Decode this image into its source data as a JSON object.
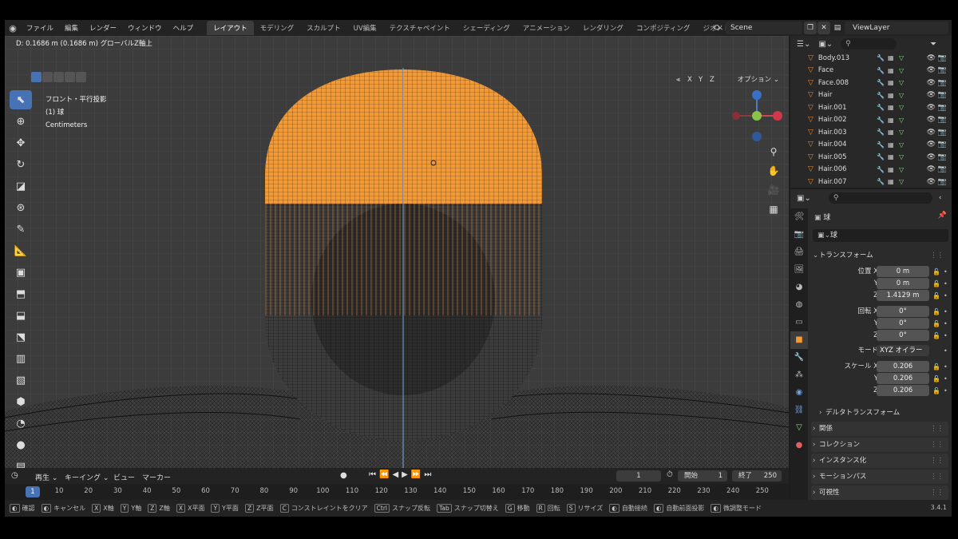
{
  "menu": [
    "ファイル",
    "編集",
    "レンダー",
    "ウィンドウ",
    "ヘルプ"
  ],
  "workspace_tabs": [
    "レイアウト",
    "モデリング",
    "スカルプト",
    "UV編集",
    "テクスチャペイント",
    "シェーディング",
    "アニメーション",
    "レンダリング",
    "コンポジティング",
    "ジオメトリ"
  ],
  "scene": "Scene",
  "view_layer": "ViewLayer",
  "viewport": {
    "status": "D: 0.1686 m (0.1686 m) グローバルZ軸上",
    "view_name": "フロント・平行投影",
    "object_info": "(1) 球",
    "units": "Centimeters",
    "axes_buttons": [
      "X",
      "Y",
      "Z"
    ],
    "option_label": "オプション"
  },
  "timeline": {
    "playback": "再生",
    "keying": "キーイング",
    "view": "ビュー",
    "marker": "マーカー",
    "current_frame": "1",
    "start_label": "開始",
    "start": "1",
    "end_label": "終了",
    "end": "250",
    "ruler": [
      "1",
      "10",
      "20",
      "30",
      "40",
      "50",
      "60",
      "70",
      "80",
      "90",
      "100",
      "110",
      "120",
      "130",
      "140",
      "150",
      "160",
      "170",
      "180",
      "190",
      "200",
      "210",
      "220",
      "230",
      "240",
      "250"
    ]
  },
  "statusbar": [
    {
      "key": "",
      "label": "確認"
    },
    {
      "key": "",
      "label": "キャンセル"
    },
    {
      "key": "X",
      "label": "X軸"
    },
    {
      "key": "Y",
      "label": "Y軸"
    },
    {
      "key": "Z",
      "label": "Z軸"
    },
    {
      "key": "X",
      "label": "X平面"
    },
    {
      "key": "Y",
      "label": "Y平面"
    },
    {
      "key": "Z",
      "label": "Z平面"
    },
    {
      "key": "C",
      "label": "コンストレイントをクリア"
    },
    {
      "key": "Ctrl",
      "label": "スナップ反転"
    },
    {
      "key": "Tab",
      "label": "スナップ切替え"
    },
    {
      "key": "G",
      "label": "移動"
    },
    {
      "key": "R",
      "label": "回転"
    },
    {
      "key": "S",
      "label": "リサイズ"
    },
    {
      "key": "",
      "label": "自動接続"
    },
    {
      "key": "",
      "label": "自動前面投影"
    },
    {
      "key": "",
      "label": "微調整モード"
    }
  ],
  "version": "3.4.1",
  "outliner": {
    "items": [
      "Body.013",
      "Face",
      "Face.008",
      "Hair",
      "Hair.001",
      "Hair.002",
      "Hair.003",
      "Hair.004",
      "Hair.005",
      "Hair.006",
      "Hair.007"
    ]
  },
  "properties": {
    "object_name": "球",
    "datablock_name": "球",
    "transform_header": "トランスフォーム",
    "location_label": "位置 X",
    "location": [
      "0 m",
      "0 m",
      "1.4129 m"
    ],
    "rotation_label": "回転 X",
    "rotation": [
      "0°",
      "0°",
      "0°"
    ],
    "mode_label": "モード",
    "mode_value": "XYZ オイラー",
    "scale_label": "スケール X",
    "scale": [
      "0.206",
      "0.206",
      "0.206"
    ],
    "axis_y": "Y",
    "axis_z": "Z",
    "delta_transform": "デルタトランスフォーム",
    "panels": [
      "関係",
      "コレクション",
      "インスタンス化",
      "モーションパス",
      "可視性"
    ]
  }
}
